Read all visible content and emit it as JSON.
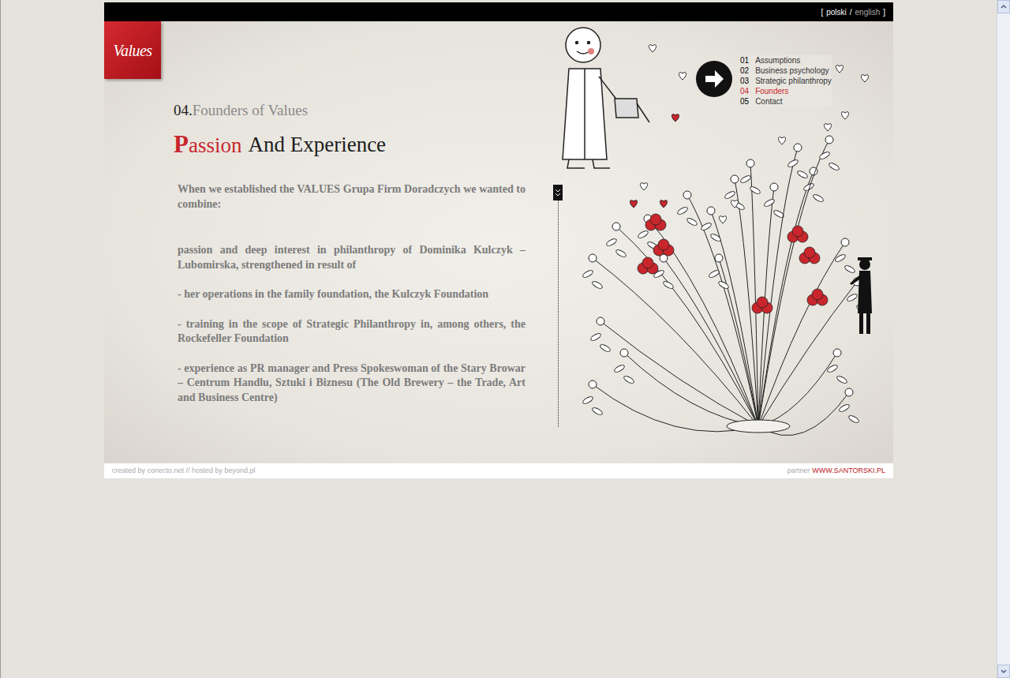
{
  "language_bar": {
    "open": "[",
    "separator": "/",
    "close": "]",
    "languages": [
      {
        "label": "polski",
        "selected": false
      },
      {
        "label": "english",
        "selected": true
      }
    ]
  },
  "logo": "Values",
  "section": {
    "number": "04.",
    "title": "Founders of Values"
  },
  "headline": [
    {
      "text": "Passion",
      "color": "#c8262c"
    },
    {
      "text": "And Experience",
      "color": "#1c1c1c"
    }
  ],
  "paragraphs": [
    "When we established the VALUES Grupa Firm Doradczych we wanted to combine:",
    "passion and deep interest in philanthropy of Dominika Kulczyk – Lubomirska, strengthened in result of",
    "- her operations in the family foundation, the Kulczyk Foundation",
    "- training in the scope of Strategic Philanthropy in, among others, the Rockefeller Foundation",
    "- experience as PR manager and Press Spokeswoman of the Stary Browar – Centrum Handlu, Sztuki i Biznesu (The Old Brewery – the Trade, Art and Business Centre)"
  ],
  "nav": [
    {
      "number": "01",
      "label": "Assumptions",
      "selected": false
    },
    {
      "number": "02",
      "label": "Business psychology",
      "selected": false
    },
    {
      "number": "03",
      "label": "Strategic philanthropy",
      "selected": false
    },
    {
      "number": "04",
      "label": "Founders",
      "selected": true
    },
    {
      "number": "05",
      "label": "Contact",
      "selected": false
    }
  ],
  "footer": {
    "credits": "created by conecto.net // hosted by beyond.pl",
    "partner_label": "partner",
    "partner_link": "WWW.SANTORSKI.PL"
  }
}
